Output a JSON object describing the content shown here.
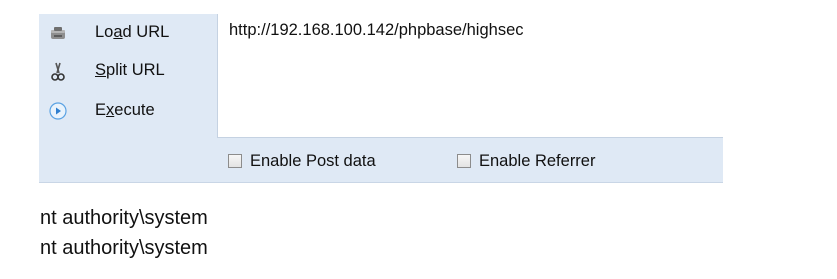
{
  "toolbar": {
    "menu": [
      {
        "pre": "Lo",
        "accel": "a",
        "post": "d URL",
        "icon": "load-url-icon"
      },
      {
        "pre": "",
        "accel": "S",
        "post": "plit URL",
        "icon": "scissors-icon"
      },
      {
        "pre": "E",
        "accel": "x",
        "post": "ecute",
        "icon": "execute-play-icon"
      }
    ],
    "url_value": "http://192.168.100.142/phpbase/highsec",
    "options": [
      {
        "label": "Enable Post data",
        "checked": false
      },
      {
        "label": "Enable Referrer",
        "checked": false
      }
    ]
  },
  "output": {
    "lines": [
      "nt authority\\system",
      "nt authority\\system"
    ]
  },
  "colors": {
    "panel_bg": "#dfe9f5",
    "execute_icon": "#3c8fd8"
  }
}
